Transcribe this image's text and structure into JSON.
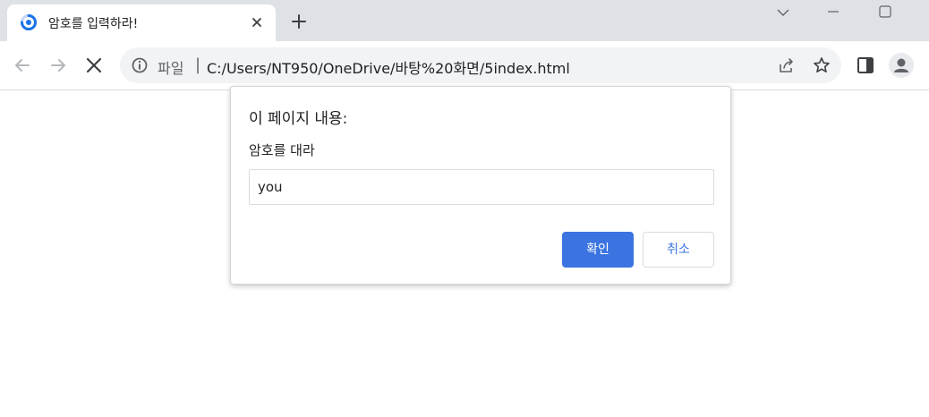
{
  "tab": {
    "title": "암호를 입력하라!",
    "favicon": "loading-spinner-icon"
  },
  "toolbar": {
    "back_icon": "arrow-left-icon",
    "forward_icon": "arrow-right-icon",
    "stop_icon": "close-icon"
  },
  "omnibox": {
    "chip_label": "파일",
    "separator": "|",
    "url": "C:/Users/NT950/OneDrive/바탕%20화면/5index.html"
  },
  "dialog": {
    "title": "이 페이지 내용:",
    "message": "암호를 대라",
    "input_value": "you",
    "ok_label": "확인",
    "cancel_label": "취소"
  },
  "colors": {
    "tabstrip_bg": "#dee1e6",
    "omnibox_bg": "#f1f3f4",
    "accent": "#3b74e0"
  }
}
